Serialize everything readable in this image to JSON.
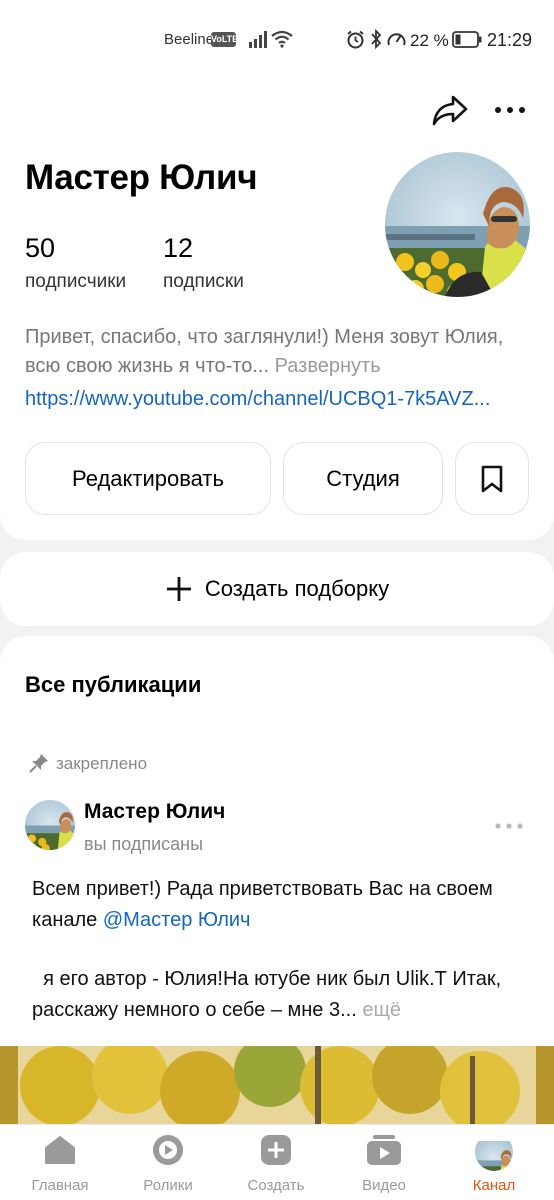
{
  "status_bar": {
    "carrier": "Beeline",
    "volte": "VoLTE",
    "battery_percent": "22 %",
    "time": "21:29",
    "icons": [
      "signal-icon",
      "wifi-icon",
      "alarm-icon",
      "bluetooth-icon",
      "speed-icon",
      "battery-icon"
    ]
  },
  "profile": {
    "name": "Мастер Юлич",
    "subscribers_count": "50",
    "subscribers_label": "подписчики",
    "subscriptions_count": "12",
    "subscriptions_label": "подписки",
    "bio": "Привет, спасибо, что заглянули!) Меня зовут Юлия, всю свою жизнь я что-то...",
    "bio_expand": "Развернуть",
    "link": "https://www.youtube.com/channel/UCBQ1-7k5AVZ..."
  },
  "actions": {
    "edit_label": "Редактировать",
    "studio_label": "Студия"
  },
  "create_collection_label": "Создать подборку",
  "feed": {
    "title": "Все публикации",
    "pinned_label": "закреплено",
    "post": {
      "author": "Мастер Юлич",
      "subtitle": "вы подписаны",
      "text_part1": "Всем привет!) Рада приветствовать Вас на своем канале ",
      "mention": "@Мастер Юлич",
      "text_part2": "  я его автор - Юлия!На ютубе ник был Ulik.Т Итак, расскажу немного о себе – мне 3...",
      "more_label": "ещё"
    }
  },
  "bottom_nav": {
    "items": [
      {
        "label": "Главная",
        "icon": "home-icon"
      },
      {
        "label": "Ролики",
        "icon": "clips-icon"
      },
      {
        "label": "Создать",
        "icon": "create-icon"
      },
      {
        "label": "Видео",
        "icon": "video-icon"
      },
      {
        "label": "Канал",
        "icon": "channel-avatar"
      }
    ],
    "active_color": "#e8520e",
    "inactive_color": "#9a9a9a"
  },
  "colors": {
    "link": "#1565c0",
    "background": "#f2f2f2"
  }
}
